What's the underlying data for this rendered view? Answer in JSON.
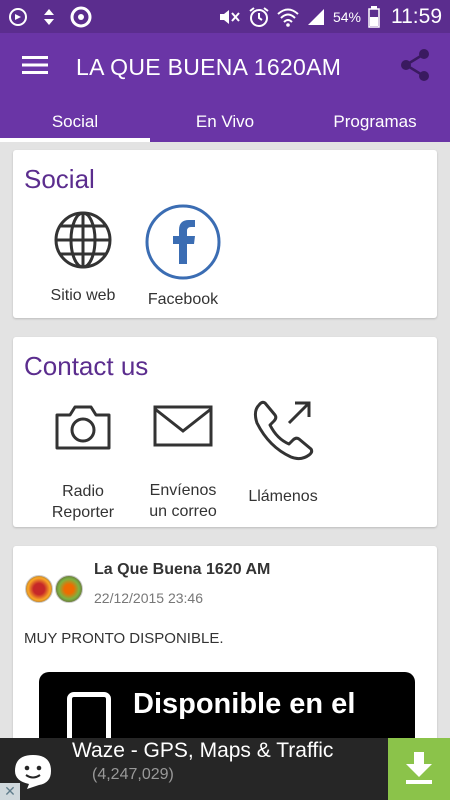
{
  "status_bar": {
    "battery_percent": "54%",
    "time": "11:59",
    "left_icons": [
      "notification-icon",
      "data-arrows-icon",
      "app-icon"
    ],
    "right_icons": [
      "mute-icon",
      "alarm-icon",
      "wifi-icon",
      "signal-icon",
      "battery-icon"
    ]
  },
  "app_bar": {
    "title": "LA QUE BUENA 1620AM"
  },
  "tabs": [
    {
      "label": "Social",
      "active": true
    },
    {
      "label": "En Vivo",
      "active": false
    },
    {
      "label": "Programas",
      "active": false
    }
  ],
  "social_card": {
    "title": "Social",
    "items": [
      {
        "label": "Sitio web",
        "icon": "globe-icon"
      },
      {
        "label": "Facebook",
        "icon": "facebook-icon"
      }
    ]
  },
  "contact_card": {
    "title": "Contact us",
    "items": [
      {
        "label_line1": "Radio",
        "label_line2": "Reporter",
        "icon": "camera-icon"
      },
      {
        "label_line1": "Envíenos",
        "label_line2": "un correo",
        "icon": "mail-icon"
      },
      {
        "label_line1": "Llámenos",
        "label_line2": "",
        "icon": "phone-call-icon"
      }
    ]
  },
  "post": {
    "author": "La Que Buena 1620 AM",
    "date": "22/12/2015 23:46",
    "text": "MUY PRONTO DISPONIBLE.",
    "badge_text": "Disponible en el"
  },
  "ad": {
    "title": "Waze - GPS, Maps & Traffic",
    "subtitle": "(4,247,029)"
  },
  "colors": {
    "primary": "#6a35a6",
    "status_bar": "#5b2d8e",
    "accent_text": "#5b2d8e",
    "download": "#8bc34a"
  }
}
